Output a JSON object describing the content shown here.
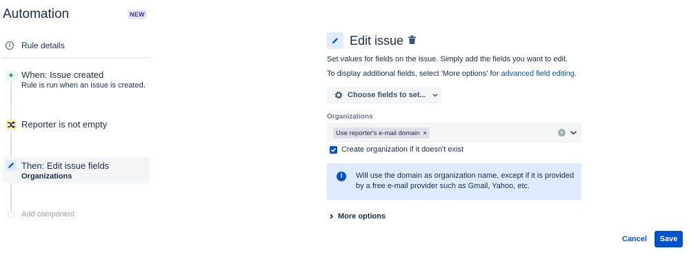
{
  "sidebar": {
    "title": "Automation",
    "badge": "NEW",
    "rule_details": "Rule details",
    "steps": [
      {
        "icon": "plus-icon",
        "title": "When: Issue created",
        "subtitle": "Rule is run when an issue is created."
      },
      {
        "icon": "shuffle-icon",
        "title": "Reporter is not empty"
      },
      {
        "icon": "pencil-icon",
        "title": "Then: Edit issue fields",
        "subtitle": "Organizations",
        "selected": true
      }
    ],
    "add_component": "Add component"
  },
  "editor": {
    "title": "Edit issue",
    "desc1": "Set values for fields on the issue. Simply add the fields you want to edit.",
    "desc2_prefix": "To display additional fields, select 'More options' for ",
    "desc2_link": "advanced field editing",
    "desc2_suffix": ".",
    "choose_fields": "Choose fields to set...",
    "field_label": "Organizations",
    "selected_tag": "Use reporter's e-mail domain",
    "tag_remove": "×",
    "clear": "×",
    "checkbox_label": "Create organization if it doesn't exist",
    "checkbox_checked": true,
    "info_line1": "Will use the domain as organization name, except if it is provided",
    "info_line2": "by a free e-mail provider such as Gmail, Yahoo, etc.",
    "more_options": "More options",
    "cancel": "Cancel",
    "save": "Save"
  },
  "colors": {
    "accent": "#0052CC",
    "text": "#172B4D",
    "subtle_bg": "#F4F5F7",
    "info_bg": "#DEEBFF",
    "trigger_bg": "#E3FCEF",
    "condition_bg": "#FFF0B3"
  }
}
